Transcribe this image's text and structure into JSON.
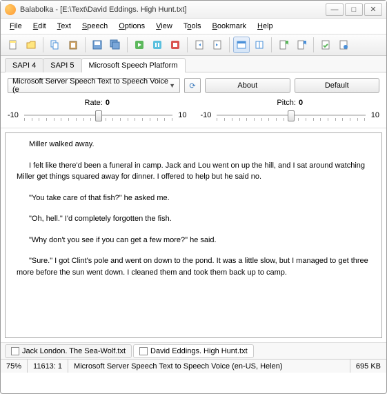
{
  "window": {
    "title": "Balabolka - [E:\\Text\\David Eddings. High Hunt.txt]"
  },
  "menu": {
    "file": "File",
    "edit": "Edit",
    "text": "Text",
    "speech": "Speech",
    "options": "Options",
    "view": "View",
    "tools": "Tools",
    "bookmark": "Bookmark",
    "help": "Help"
  },
  "tabs": {
    "sapi4": "SAPI 4",
    "sapi5": "SAPI 5",
    "msp": "Microsoft Speech Platform"
  },
  "voice": {
    "selected": "Microsoft Server Speech Text to Speech Voice (e",
    "about": "About",
    "default": "Default"
  },
  "sliders": {
    "rate_label": "Rate:",
    "rate_value": "0",
    "rate_min": "-10",
    "rate_max": "10",
    "pitch_label": "Pitch:",
    "pitch_value": "0",
    "pitch_min": "-10",
    "pitch_max": "10"
  },
  "content": {
    "p1": "Miller walked away.",
    "p2": "I felt like there'd been a funeral in camp. Jack and Lou went on up the hill, and I sat around watching Miller get things squared away for dinner. I offered to help but he said no.",
    "p3": "\"You take care of that fish?\" he asked me.",
    "p4": "\"Oh, hell.\" I'd completely forgotten the fish.",
    "p5": "\"Why don't you see if you can get a few more?\" he said.",
    "p6": "\"Sure.\" I got Clint's pole and went on down to the pond. It was a little slow, but I managed to get three more before the sun went down. I cleaned them and took them back up to camp."
  },
  "doctabs": {
    "t1": "Jack London. The Sea-Wolf.txt",
    "t2": "David Eddings. High Hunt.txt"
  },
  "status": {
    "zoom": "75%",
    "pos": "11613:  1",
    "voice": "Microsoft Server Speech Text to Speech Voice (en-US, Helen)",
    "size": "695 KB"
  }
}
